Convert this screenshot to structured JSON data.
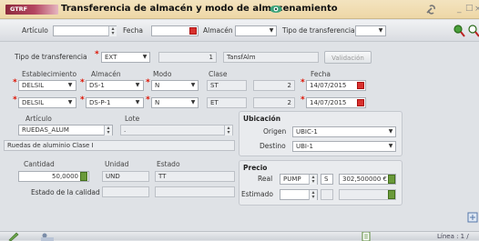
{
  "window": {
    "tag": "GTRF",
    "title": "Transferencia de almacén y modo de almacenamiento"
  },
  "filter": {
    "articulo_label": "Artículo",
    "fecha_label": "Fecha",
    "almacen_label": "Almacén",
    "tipo_label": "Tipo de transferencia"
  },
  "header": {
    "tipo_label": "Tipo de transferencia",
    "tipo_value": "EXT",
    "num_value": "1",
    "desc_value": "TansfAlm",
    "validacion_label": "Validación"
  },
  "columns": {
    "establecimiento": "Establecimiento",
    "almacen": "Almacén",
    "modo": "Modo",
    "clase": "Clase",
    "fecha": "Fecha"
  },
  "rows": [
    {
      "establecimiento": "DELSIL",
      "almacen": "DS-1",
      "modo": "N",
      "clase": "ST",
      "num": "2",
      "fecha": "14/07/2015"
    },
    {
      "establecimiento": "DELSIL",
      "almacen": "DS-P-1",
      "modo": "N",
      "clase": "ET",
      "num": "2",
      "fecha": "14/07/2015"
    }
  ],
  "article": {
    "articulo_label": "Artículo",
    "lote_label": "Lote",
    "articulo_value": "RUEDAS_ALUM",
    "lote_value": ".",
    "description": "Ruedas de aluminio Clase I"
  },
  "ubicacion": {
    "title": "Ubicación",
    "origen_label": "Origen",
    "origen_value": "UBIC-1",
    "destino_label": "Destino",
    "destino_value": "UBI-1"
  },
  "quantity": {
    "cantidad_label": "Cantidad",
    "unidad_label": "Unidad",
    "estado_label": "Estado",
    "cantidad_value": "50,0000",
    "unidad_value": "UND",
    "estado_value": "TT",
    "calidad_label": "Estado de la calidad"
  },
  "precio": {
    "title": "Precio",
    "real_label": "Real",
    "real_method": "PUMP",
    "real_code": "S",
    "real_value": "302,500000 €",
    "estimado_label": "Estimado"
  },
  "status": {
    "line": "Línea : 1 /"
  },
  "colors": {
    "title_bg": "#f0dcae",
    "tag_bg": "#a23b53",
    "required": "#dd1100"
  }
}
